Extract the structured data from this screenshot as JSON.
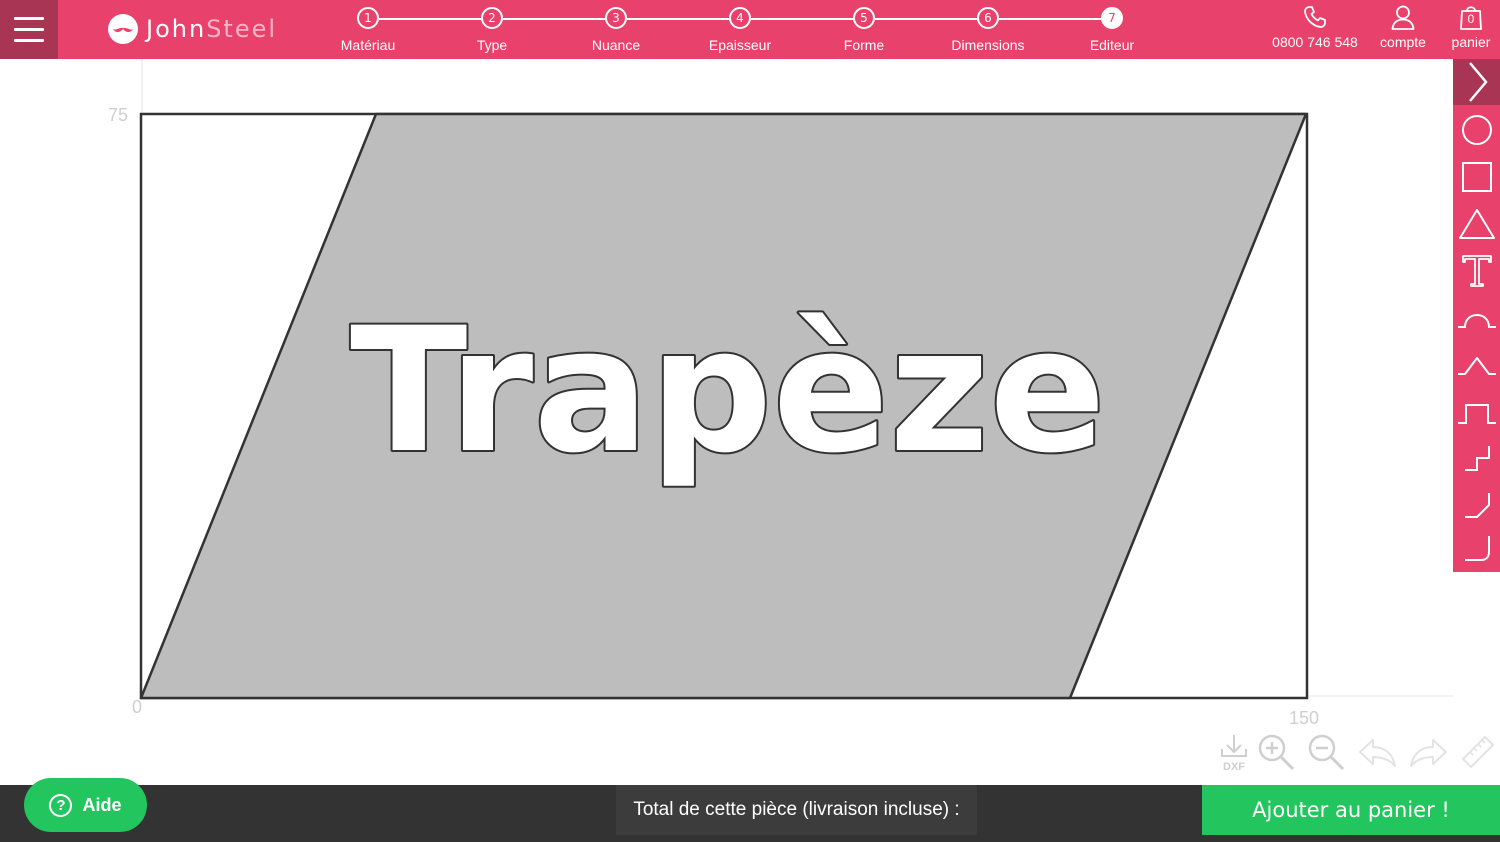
{
  "header": {
    "brand_part1": "John",
    "brand_part2": "Steel",
    "steps": [
      {
        "number": "1",
        "label": "Matériau"
      },
      {
        "number": "2",
        "label": "Type"
      },
      {
        "number": "3",
        "label": "Nuance"
      },
      {
        "number": "4",
        "label": "Epaisseur"
      },
      {
        "number": "5",
        "label": "Forme"
      },
      {
        "number": "6",
        "label": "Dimensions"
      },
      {
        "number": "7",
        "label": "Editeur",
        "active": true
      }
    ],
    "phone": "0800 746 548",
    "account_label": "compte",
    "cart_label": "panier",
    "cart_count": "0"
  },
  "editor": {
    "shape_text": "Trapèze",
    "axis_y_max": "75",
    "axis_x_min": "0",
    "axis_x_max": "150",
    "fill_color": "#bdbdbd",
    "outline_color": "#333333"
  },
  "toolbar": {
    "tools": [
      "chevron-right-icon",
      "circle-tool-icon",
      "square-tool-icon",
      "triangle-tool-icon",
      "text-tool-icon",
      "arc-tool-icon",
      "chevron-tool-icon",
      "notch-tool-icon",
      "step-tool-icon",
      "fillet-tool-icon",
      "corner-tool-icon"
    ]
  },
  "view_tools": {
    "dxf_label": "DXF"
  },
  "footer": {
    "help_label": "Aide",
    "total_label": "Total de cette pièce (livraison incluse) :",
    "add_to_cart_label": "Ajouter au panier !"
  },
  "colors": {
    "brand": "#e8416b",
    "brand_dark": "#a93555",
    "success": "#22c55e",
    "footer_bg": "#333333"
  }
}
